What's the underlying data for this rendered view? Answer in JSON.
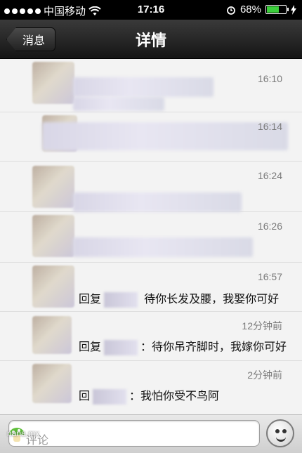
{
  "status_bar": {
    "carrier": "中国移动",
    "time": "17:16",
    "battery_percent": "68%",
    "battery_level": 0.68,
    "icons": [
      "signal-dots",
      "wifi-icon",
      "alarm-icon",
      "battery-icon",
      "charging-icon"
    ]
  },
  "nav": {
    "back_label": "消息",
    "title": "详情"
  },
  "list": {
    "items": [
      {
        "time": "16:10"
      },
      {
        "time": "16:14"
      },
      {
        "time": "16:24"
      },
      {
        "time": "16:26"
      },
      {
        "time": "16:57",
        "prefix": "回复",
        "text": "待你长发及腰，我娶你可好"
      },
      {
        "time": "12分钟前",
        "prefix": "回复",
        "text": "：待你吊齐脚时，我嫁你可好"
      },
      {
        "time": "2分钟前",
        "prefix": "回",
        "text": "：我怕你受不鸟阿"
      }
    ]
  },
  "comment_bar": {
    "placeholder": "评论",
    "emoji_icon": "smiley-face-icon"
  },
  "watermark": "nana.mx",
  "colors": {
    "nav_bg": "#1e1e1e",
    "status_bg": "#000000",
    "list_bg": "#f3f3f3",
    "timestamp": "#7a7a7a",
    "battery_fill": "#3ccf3c"
  }
}
